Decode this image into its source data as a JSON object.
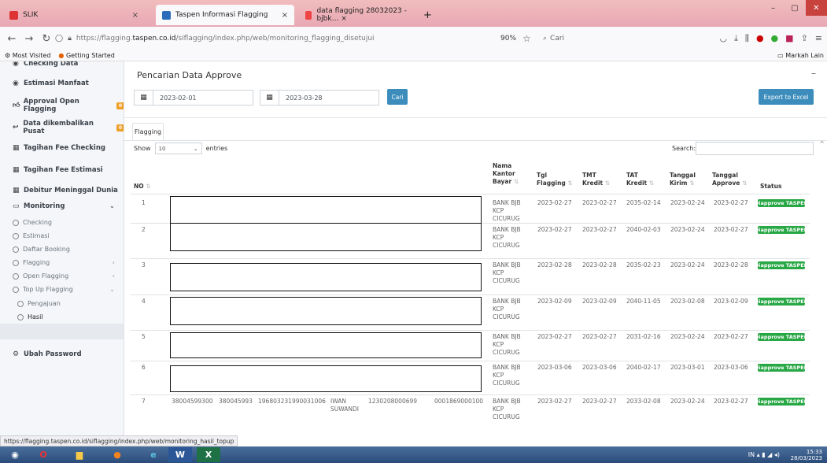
{
  "browser": {
    "tabs": [
      {
        "label": "SLIK",
        "close": "×"
      },
      {
        "label": "Taspen Informasi Flagging",
        "close": "×"
      },
      {
        "label": "data flagging 28032023 - bjbk… ×",
        "close": ""
      }
    ],
    "new_tab": "+",
    "url_prefix": "https://flagging.",
    "url_domain": "taspen.co.id",
    "url_path": "/siflagging/index.php/web/monitoring_flagging_disetujui",
    "zoom": "90%",
    "search_placeholder": "Cari",
    "bookmarks": [
      "Most Visited",
      "Getting Started"
    ],
    "bookmarks_right": "Markah Lain",
    "status_url": "https://flagging.taspen.co.id/siflagging/index.php/web/monitoring_hasil_topup"
  },
  "sidebar": {
    "items": [
      {
        "label": "Checking Data"
      },
      {
        "label": "Estimasi Manfaat"
      },
      {
        "label": "Approval Open Flagging",
        "badge": "0"
      },
      {
        "label": "Data dikembalikan Pusat",
        "badge": "0"
      },
      {
        "label": "Tagihan Fee Checking"
      },
      {
        "label": "Tagihan Fee Estimasi"
      },
      {
        "label": "Debitur Meninggal Dunia"
      },
      {
        "label": "Monitoring"
      }
    ],
    "sub_items": [
      "Checking",
      "Estimasi",
      "Daftar Booking",
      "Flagging",
      "Open Flagging",
      "Top Up Flagging"
    ],
    "topup_sub": [
      "Pengajuan",
      "Hasil"
    ],
    "password": "Ubah Password"
  },
  "main": {
    "card_title": "Pencarian Data Approve",
    "date_from": "2023-02-01",
    "date_to": "2023-03-28",
    "search_button": "Cari",
    "export_button": "Export to Excel",
    "tab": "Flagging",
    "show_label": "Show",
    "show_value": "10",
    "entries_label": "entries",
    "search_label": "Search:",
    "columns": {
      "no": "NO",
      "kantor": [
        "Nama",
        "Kantor",
        "Bayar"
      ],
      "tgl_flagging": [
        "Tgl",
        "Flagging"
      ],
      "tmt_kredit": [
        "TMT",
        "Kredit"
      ],
      "tat_kredit": [
        "TAT",
        "Kredit"
      ],
      "tgl_kirim": [
        "Tanggal",
        "Kirim"
      ],
      "tgl_approve": [
        "Tanggal",
        "Approve"
      ],
      "status": "Status"
    },
    "rows": [
      {
        "no": "1",
        "kantor": [
          "BANK BJB",
          "KCP",
          "CICURUG"
        ],
        "tgl_flagging": "2023-02-27",
        "tmt": "2023-02-27",
        "tat": "2035-02-14",
        "kirim": "2023-02-24",
        "approve": "2023-02-27",
        "status": "Diapprove TASPEN"
      },
      {
        "no": "2",
        "kantor": [
          "BANK BJB",
          "KCP",
          "CICURUG"
        ],
        "tgl_flagging": "2023-02-27",
        "tmt": "2023-02-27",
        "tat": "2040-02-03",
        "kirim": "2023-02-24",
        "approve": "2023-02-27",
        "status": "Diapprove TASPEN"
      },
      {
        "no": "3",
        "kantor": [
          "BANK BJB",
          "KCP",
          "CICURUG"
        ],
        "tgl_flagging": "2023-02-28",
        "tmt": "2023-02-28",
        "tat": "2035-02-23",
        "kirim": "2023-02-24",
        "approve": "2023-02-28",
        "status": "Diapprove TASPEN"
      },
      {
        "no": "4",
        "kantor": [
          "BANK BJB",
          "KCP",
          "CICURUG"
        ],
        "tgl_flagging": "2023-02-09",
        "tmt": "2023-02-09",
        "tat": "2040-11-05",
        "kirim": "2023-02-08",
        "approve": "2023-02-09",
        "status": "Diapprove TASPEN"
      },
      {
        "no": "5",
        "kantor": [
          "BANK BJB",
          "KCP",
          "CICURUG"
        ],
        "tgl_flagging": "2023-02-27",
        "tmt": "2023-02-27",
        "tat": "2031-02-16",
        "kirim": "2023-02-24",
        "approve": "2023-02-27",
        "status": "Diapprove TASPEN"
      },
      {
        "no": "6",
        "kantor": [
          "BANK BJB",
          "KCP",
          "CICURUG"
        ],
        "tgl_flagging": "2023-03-06",
        "tmt": "2023-03-06",
        "tat": "2040-02-17",
        "kirim": "2023-03-01",
        "approve": "2023-03-06",
        "status": "Diapprove TASPEN"
      },
      {
        "no": "7",
        "kantor": [
          "BANK BJB",
          "KCP",
          "CICURUG"
        ],
        "tgl_flagging": "2023-02-27",
        "tmt": "2023-02-27",
        "tat": "2033-02-08",
        "kirim": "2023-02-24",
        "approve": "2023-02-27",
        "status": "Diapprove TASPEN",
        "extra": {
          "c1": "38004599300",
          "c2": "380045993",
          "c3": "196803231990031006",
          "c4": [
            "IWAN",
            "SUWANDI"
          ],
          "c5": "1230208000699",
          "c6": "0001869000100"
        }
      }
    ]
  },
  "taskbar": {
    "lang": "IN",
    "time": "15:33",
    "date": "28/03/2023"
  },
  "colors": {
    "accent": "#3c8dbc",
    "status_green": "#28a745",
    "badge": "#f0a028"
  }
}
